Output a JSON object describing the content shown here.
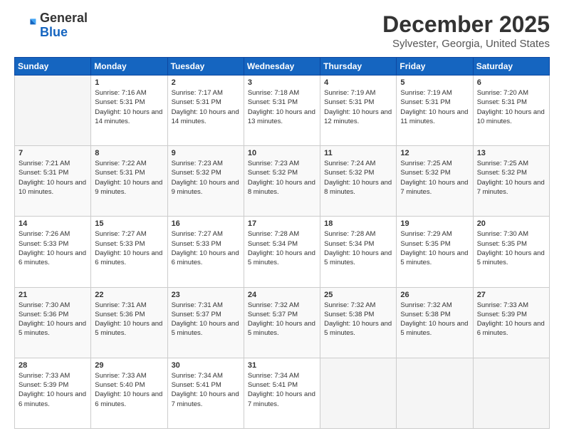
{
  "header": {
    "logo_general": "General",
    "logo_blue": "Blue",
    "month_title": "December 2025",
    "location": "Sylvester, Georgia, United States"
  },
  "weekdays": [
    "Sunday",
    "Monday",
    "Tuesday",
    "Wednesday",
    "Thursday",
    "Friday",
    "Saturday"
  ],
  "weeks": [
    [
      {
        "day": "",
        "sunrise": "",
        "sunset": "",
        "daylight": ""
      },
      {
        "day": "1",
        "sunrise": "Sunrise: 7:16 AM",
        "sunset": "Sunset: 5:31 PM",
        "daylight": "Daylight: 10 hours and 14 minutes."
      },
      {
        "day": "2",
        "sunrise": "Sunrise: 7:17 AM",
        "sunset": "Sunset: 5:31 PM",
        "daylight": "Daylight: 10 hours and 14 minutes."
      },
      {
        "day": "3",
        "sunrise": "Sunrise: 7:18 AM",
        "sunset": "Sunset: 5:31 PM",
        "daylight": "Daylight: 10 hours and 13 minutes."
      },
      {
        "day": "4",
        "sunrise": "Sunrise: 7:19 AM",
        "sunset": "Sunset: 5:31 PM",
        "daylight": "Daylight: 10 hours and 12 minutes."
      },
      {
        "day": "5",
        "sunrise": "Sunrise: 7:19 AM",
        "sunset": "Sunset: 5:31 PM",
        "daylight": "Daylight: 10 hours and 11 minutes."
      },
      {
        "day": "6",
        "sunrise": "Sunrise: 7:20 AM",
        "sunset": "Sunset: 5:31 PM",
        "daylight": "Daylight: 10 hours and 10 minutes."
      }
    ],
    [
      {
        "day": "7",
        "sunrise": "Sunrise: 7:21 AM",
        "sunset": "Sunset: 5:31 PM",
        "daylight": "Daylight: 10 hours and 10 minutes."
      },
      {
        "day": "8",
        "sunrise": "Sunrise: 7:22 AM",
        "sunset": "Sunset: 5:31 PM",
        "daylight": "Daylight: 10 hours and 9 minutes."
      },
      {
        "day": "9",
        "sunrise": "Sunrise: 7:23 AM",
        "sunset": "Sunset: 5:32 PM",
        "daylight": "Daylight: 10 hours and 9 minutes."
      },
      {
        "day": "10",
        "sunrise": "Sunrise: 7:23 AM",
        "sunset": "Sunset: 5:32 PM",
        "daylight": "Daylight: 10 hours and 8 minutes."
      },
      {
        "day": "11",
        "sunrise": "Sunrise: 7:24 AM",
        "sunset": "Sunset: 5:32 PM",
        "daylight": "Daylight: 10 hours and 8 minutes."
      },
      {
        "day": "12",
        "sunrise": "Sunrise: 7:25 AM",
        "sunset": "Sunset: 5:32 PM",
        "daylight": "Daylight: 10 hours and 7 minutes."
      },
      {
        "day": "13",
        "sunrise": "Sunrise: 7:25 AM",
        "sunset": "Sunset: 5:32 PM",
        "daylight": "Daylight: 10 hours and 7 minutes."
      }
    ],
    [
      {
        "day": "14",
        "sunrise": "Sunrise: 7:26 AM",
        "sunset": "Sunset: 5:33 PM",
        "daylight": "Daylight: 10 hours and 6 minutes."
      },
      {
        "day": "15",
        "sunrise": "Sunrise: 7:27 AM",
        "sunset": "Sunset: 5:33 PM",
        "daylight": "Daylight: 10 hours and 6 minutes."
      },
      {
        "day": "16",
        "sunrise": "Sunrise: 7:27 AM",
        "sunset": "Sunset: 5:33 PM",
        "daylight": "Daylight: 10 hours and 6 minutes."
      },
      {
        "day": "17",
        "sunrise": "Sunrise: 7:28 AM",
        "sunset": "Sunset: 5:34 PM",
        "daylight": "Daylight: 10 hours and 5 minutes."
      },
      {
        "day": "18",
        "sunrise": "Sunrise: 7:28 AM",
        "sunset": "Sunset: 5:34 PM",
        "daylight": "Daylight: 10 hours and 5 minutes."
      },
      {
        "day": "19",
        "sunrise": "Sunrise: 7:29 AM",
        "sunset": "Sunset: 5:35 PM",
        "daylight": "Daylight: 10 hours and 5 minutes."
      },
      {
        "day": "20",
        "sunrise": "Sunrise: 7:30 AM",
        "sunset": "Sunset: 5:35 PM",
        "daylight": "Daylight: 10 hours and 5 minutes."
      }
    ],
    [
      {
        "day": "21",
        "sunrise": "Sunrise: 7:30 AM",
        "sunset": "Sunset: 5:36 PM",
        "daylight": "Daylight: 10 hours and 5 minutes."
      },
      {
        "day": "22",
        "sunrise": "Sunrise: 7:31 AM",
        "sunset": "Sunset: 5:36 PM",
        "daylight": "Daylight: 10 hours and 5 minutes."
      },
      {
        "day": "23",
        "sunrise": "Sunrise: 7:31 AM",
        "sunset": "Sunset: 5:37 PM",
        "daylight": "Daylight: 10 hours and 5 minutes."
      },
      {
        "day": "24",
        "sunrise": "Sunrise: 7:32 AM",
        "sunset": "Sunset: 5:37 PM",
        "daylight": "Daylight: 10 hours and 5 minutes."
      },
      {
        "day": "25",
        "sunrise": "Sunrise: 7:32 AM",
        "sunset": "Sunset: 5:38 PM",
        "daylight": "Daylight: 10 hours and 5 minutes."
      },
      {
        "day": "26",
        "sunrise": "Sunrise: 7:32 AM",
        "sunset": "Sunset: 5:38 PM",
        "daylight": "Daylight: 10 hours and 5 minutes."
      },
      {
        "day": "27",
        "sunrise": "Sunrise: 7:33 AM",
        "sunset": "Sunset: 5:39 PM",
        "daylight": "Daylight: 10 hours and 6 minutes."
      }
    ],
    [
      {
        "day": "28",
        "sunrise": "Sunrise: 7:33 AM",
        "sunset": "Sunset: 5:39 PM",
        "daylight": "Daylight: 10 hours and 6 minutes."
      },
      {
        "day": "29",
        "sunrise": "Sunrise: 7:33 AM",
        "sunset": "Sunset: 5:40 PM",
        "daylight": "Daylight: 10 hours and 6 minutes."
      },
      {
        "day": "30",
        "sunrise": "Sunrise: 7:34 AM",
        "sunset": "Sunset: 5:41 PM",
        "daylight": "Daylight: 10 hours and 7 minutes."
      },
      {
        "day": "31",
        "sunrise": "Sunrise: 7:34 AM",
        "sunset": "Sunset: 5:41 PM",
        "daylight": "Daylight: 10 hours and 7 minutes."
      },
      {
        "day": "",
        "sunrise": "",
        "sunset": "",
        "daylight": ""
      },
      {
        "day": "",
        "sunrise": "",
        "sunset": "",
        "daylight": ""
      },
      {
        "day": "",
        "sunrise": "",
        "sunset": "",
        "daylight": ""
      }
    ]
  ]
}
